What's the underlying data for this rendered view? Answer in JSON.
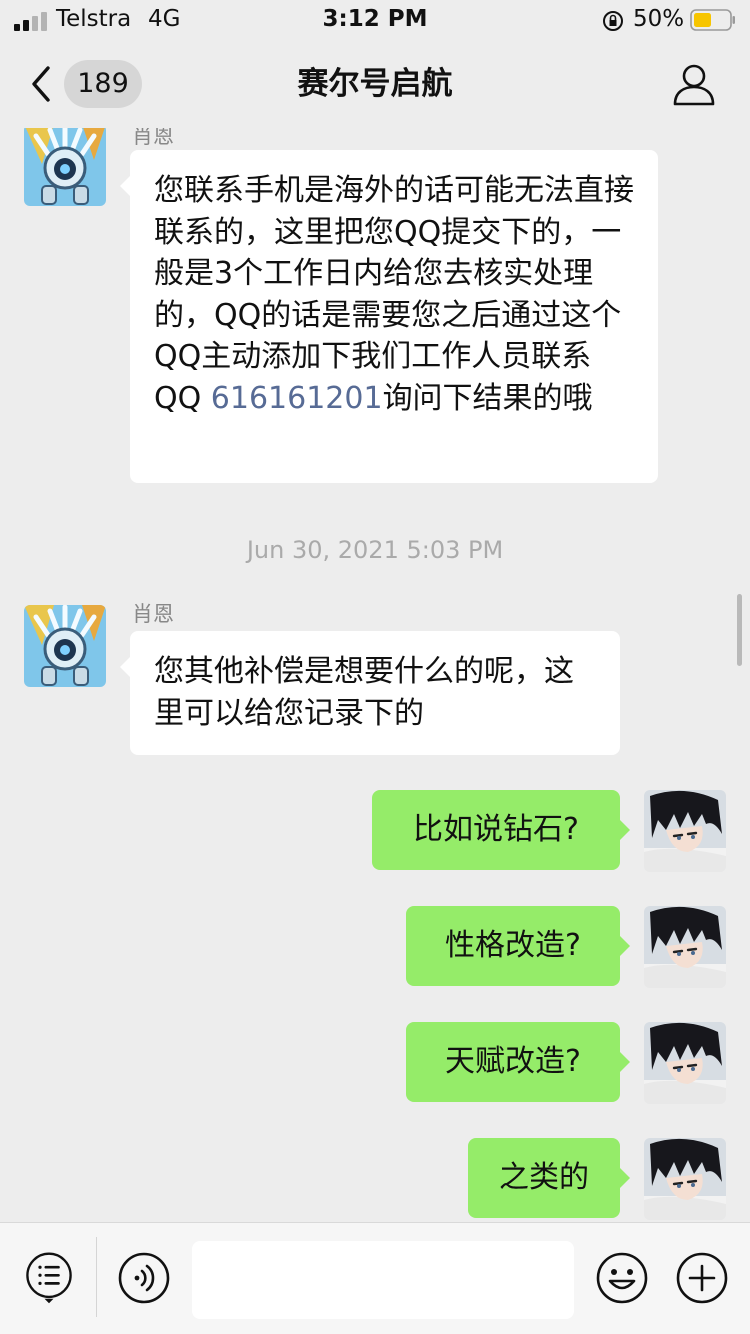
{
  "status_bar": {
    "carrier": "Telstra",
    "network": "4G",
    "time": "3:12 PM",
    "battery_percent": "50%",
    "battery_level": 0.5,
    "battery_color": "#f7c500",
    "signal_bars_active": 2,
    "signal_bars_total": 4
  },
  "nav": {
    "back_icon": "chevron-left-icon",
    "unread_count": "189",
    "title": "赛尔号启航",
    "profile_icon": "person-icon"
  },
  "messages": {
    "m1": {
      "sender": "肖恩",
      "text_before_link": "您联系手机是海外的话可能无法直接联系的，这里把您QQ提交下的，一般是3个工作日内给您去核实处理的，QQ的话是需要您之后通过这个QQ主动添加下我们工作人员联系QQ ",
      "link": "616161201",
      "text_after_link": "询问下结果的哦"
    },
    "timestamp": "Jun 30, 2021 5:03 PM",
    "m2": {
      "sender": "肖恩",
      "text": "您其他补偿是想要什么的呢，这里可以给您记录下的"
    },
    "m3": {
      "text": "比如说钻石?"
    },
    "m4": {
      "text": "性格改造?"
    },
    "m5": {
      "text": "天赋改造?"
    },
    "m6": {
      "text": "之类的"
    }
  },
  "input_bar": {
    "menu_icon": "list-menu-icon",
    "voice_icon": "voice-icon",
    "input_value": "",
    "emoji_icon": "smiley-icon",
    "more_icon": "plus-icon"
  },
  "colors": {
    "background": "#ededed",
    "self_bubble": "#95ec69",
    "other_bubble": "#ffffff",
    "link": "#576b95"
  }
}
